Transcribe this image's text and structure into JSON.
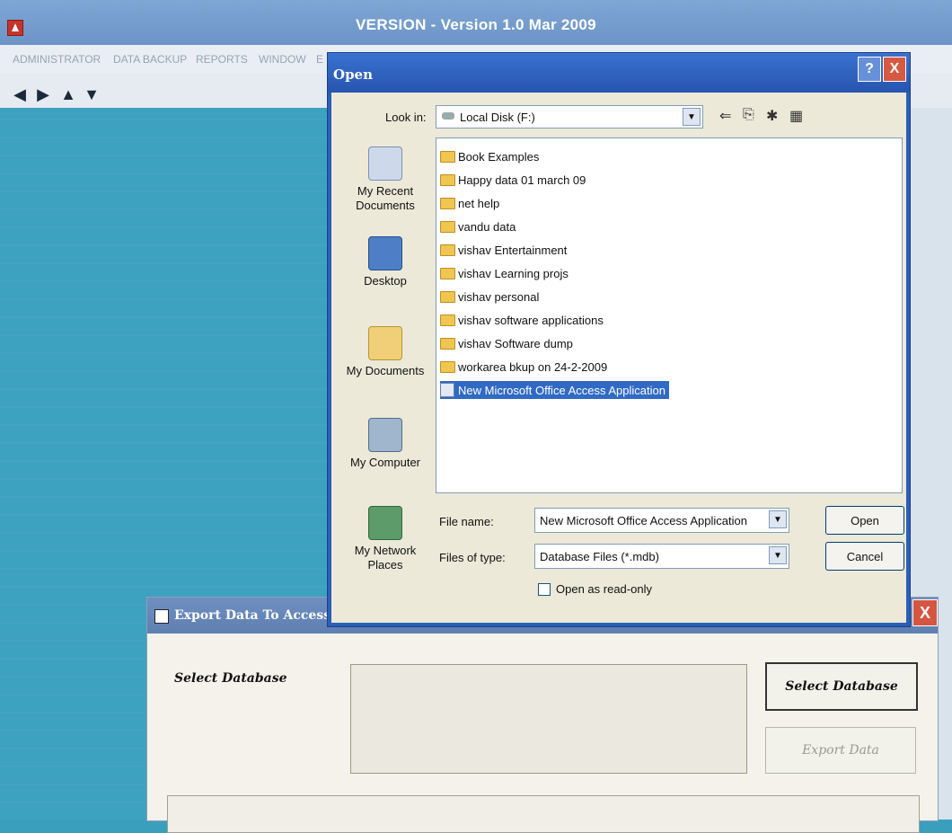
{
  "app": {
    "title": "VERSION - Version 1.0 Mar 2009",
    "menu": [
      "ADMINISTRATOR",
      "DATA BACKUP",
      "REPORTS",
      "WINDOW",
      "E"
    ],
    "toolbar_icons": [
      "first-record-icon",
      "next-record-icon",
      "up-record-icon",
      "down-record-icon"
    ]
  },
  "open_dialog": {
    "title": "Open",
    "help": "?",
    "close": "X",
    "look_in_label": "Look in:",
    "look_in_value": "Local Disk (F:)",
    "places": [
      "My Recent\nDocuments",
      "Desktop",
      "My Documents",
      "My Computer",
      "My Network\nPlaces"
    ],
    "files": [
      {
        "name": "Book Examples",
        "type": "folder"
      },
      {
        "name": "Happy data 01 march 09",
        "type": "folder"
      },
      {
        "name": "net help",
        "type": "folder"
      },
      {
        "name": "vandu data",
        "type": "folder"
      },
      {
        "name": "vishav Entertainment",
        "type": "folder"
      },
      {
        "name": "vishav Learning projs",
        "type": "folder"
      },
      {
        "name": "vishav personal",
        "type": "folder"
      },
      {
        "name": "vishav software applications",
        "type": "folder"
      },
      {
        "name": "vishav Software dump",
        "type": "folder"
      },
      {
        "name": "workarea bkup on 24-2-2009",
        "type": "folder"
      },
      {
        "name": "New Microsoft Office Access Application",
        "type": "mdb",
        "selected": true
      }
    ],
    "file_name_label": "File name:",
    "file_name_value": "New Microsoft Office Access Application",
    "files_of_type_label": "Files of type:",
    "files_of_type_value": "Database Files (*.mdb)",
    "open_button": "Open",
    "cancel_button": "Cancel",
    "read_only_label": "Open as read-only"
  },
  "export_dialog": {
    "title": "Export Data To Access",
    "close": "X",
    "select_database_label": "Select Database",
    "select_database_button": "Select Database",
    "export_data_button": "Export Data"
  }
}
